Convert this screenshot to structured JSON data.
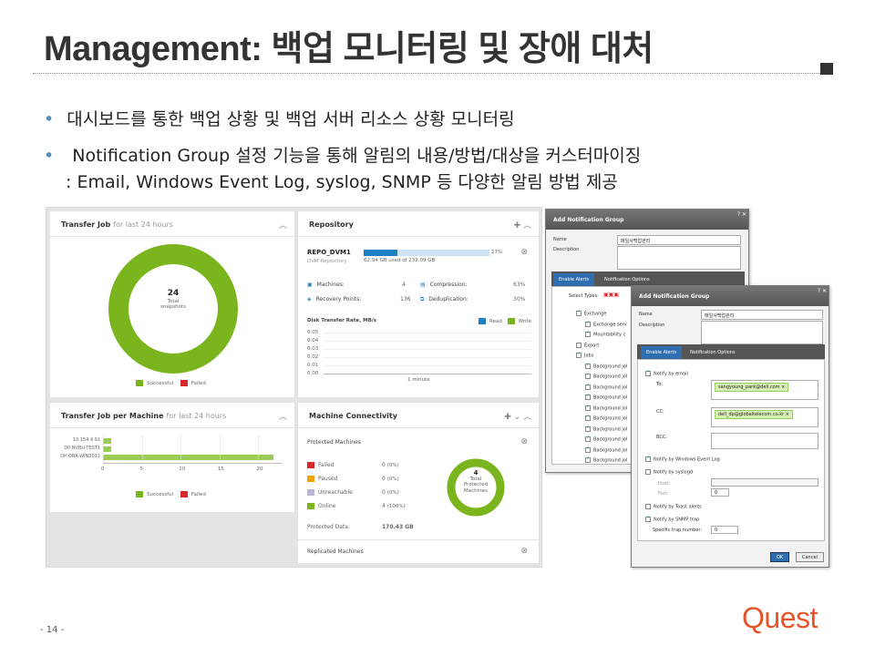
{
  "slide": {
    "title": "Management: 백업 모니터링 및 장애 대처",
    "bullets": [
      "대시보드를 통한 백업 상황 및 백업 서버 리소스 상황 모니터링",
      " Notification Group 설정 기능을 통해 알림의 내용/방법/대상을 커스터마이징"
    ],
    "bullet2_cont": ": Email, Windows Event Log, syslog, SNMP 등 다양한 알림 방법 제공",
    "page_number": "- 14 -",
    "logo": "Quest"
  },
  "colors": {
    "accent": "#e8542a",
    "green": "#7ab51d",
    "red": "#d9262b",
    "blue": "#1c7fc1",
    "orange": "#f0a30a"
  },
  "transfer_job": {
    "title": "Transfer Job",
    "subtitle": "for last 24 hours",
    "center_value": "24",
    "center_label1": "Total",
    "center_label2": "snapshots",
    "legend_success": "Successful",
    "legend_failed": "Failed"
  },
  "repository": {
    "title": "Repository",
    "name": "REPO_DVM1",
    "type": "DVM Repository",
    "usage_pct": "27%",
    "usage_fraction": 0.27,
    "usage_text": "62.94 GB used of 232.09 GB",
    "machines_label": "Machines:",
    "machines_value": "4",
    "compression_label": "Compression:",
    "compression_value": "63%",
    "recovery_label": "Recovery Points:",
    "recovery_value": "136",
    "dedup_label": "Deduplication:",
    "dedup_value": "30%",
    "rate_title": "Disk Transfer Rate, MB/s",
    "legend_read": "Read",
    "legend_write": "Write",
    "y_ticks": [
      "0.05",
      "0.04",
      "0.03",
      "0.02",
      "0.01",
      "0.00"
    ],
    "x_label": "1 minute"
  },
  "transfer_per_machine": {
    "title": "Transfer Job per Machine",
    "subtitle": "for last 24 hours",
    "machines": [
      {
        "name": "10.154.4.91",
        "successful": 1,
        "failed": 0
      },
      {
        "name": "DP-NVBU-TEST1",
        "successful": 1,
        "failed": 0
      },
      {
        "name": "DP-ORA-WIN2012",
        "successful": 22,
        "failed": 0
      }
    ],
    "x_ticks": [
      "0",
      "5",
      "10",
      "15",
      "20"
    ],
    "x_max": 23,
    "legend_success": "Successful",
    "legend_failed": "Failed"
  },
  "connectivity": {
    "title": "Machine Connectivity",
    "protected_title": "Protected Machines",
    "rows": [
      {
        "label": "Failed",
        "count": "0",
        "pct": "(0%)"
      },
      {
        "label": "Paused",
        "count": "0",
        "pct": "(0%)"
      },
      {
        "label": "Unreachable",
        "count": "0",
        "pct": "(0%)"
      },
      {
        "label": "Online",
        "count": "4",
        "pct": "(100%)"
      }
    ],
    "protected_data_label": "Protected Data:",
    "protected_data_value": "170.43 GB",
    "donut_value": "4",
    "donut_l1": "Total",
    "donut_l2": "Protected",
    "donut_l3": "Machines",
    "replicated_title": "Replicated Machines"
  },
  "dialog1": {
    "title": "Add Notification Group",
    "name_label": "Name",
    "name_value": "매일사백업관리",
    "desc_label": "Description",
    "tab_alerts": "Enable Alerts",
    "tab_options": "Notification Options",
    "select_types": "Select Types:",
    "tree": [
      "Exchange",
      "Exchange serv",
      "Mountability c",
      "Export",
      "Jobs",
      "Background jol",
      "Background jol",
      "Background jol",
      "Background jol",
      "Background jol",
      "Background jol",
      "Background jol",
      "Background jol",
      "Background jol",
      "Background jol"
    ]
  },
  "dialog2": {
    "title": "Add Notification Group",
    "name_label": "Name",
    "name_value": "매일사백업관리",
    "desc_label": "Description",
    "tab_alerts": "Enable Alerts",
    "tab_options": "Notification Options",
    "notify_email": "Notify by email",
    "to_label": "To:",
    "to_value": "sangyoung_park@dell.com",
    "cc_label": "CC:",
    "cc_value": "dell_dp@globaltelecom.co.kr",
    "bcc_label": "BCC:",
    "notify_event": "Notify by Windows Event Log",
    "notify_syslog": "Notify by syslogd",
    "host_label": "Host:",
    "port_label": "Port:",
    "port_value": "0",
    "notify_toast": "Notify by Toast alerts",
    "notify_snmp": "Notify by SNMP trap",
    "trap_label": "Specific trap number:",
    "trap_value": "0",
    "ok": "OK",
    "cancel": "Cancel"
  }
}
